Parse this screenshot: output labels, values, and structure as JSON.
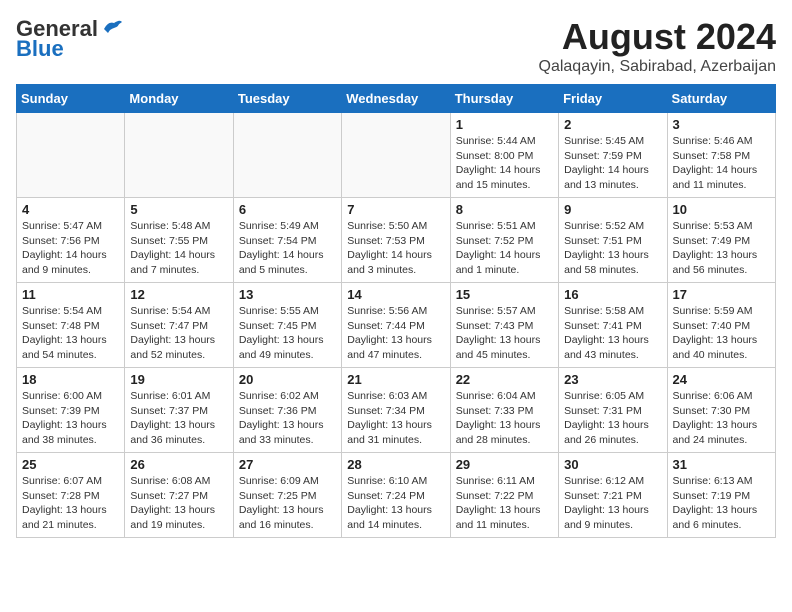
{
  "header": {
    "logo_general": "General",
    "logo_blue": "Blue",
    "month_title": "August 2024",
    "location": "Qalaqayin, Sabirabad, Azerbaijan"
  },
  "weekdays": [
    "Sunday",
    "Monday",
    "Tuesday",
    "Wednesday",
    "Thursday",
    "Friday",
    "Saturday"
  ],
  "weeks": [
    [
      {
        "day": "",
        "info": ""
      },
      {
        "day": "",
        "info": ""
      },
      {
        "day": "",
        "info": ""
      },
      {
        "day": "",
        "info": ""
      },
      {
        "day": "1",
        "info": "Sunrise: 5:44 AM\nSunset: 8:00 PM\nDaylight: 14 hours\nand 15 minutes."
      },
      {
        "day": "2",
        "info": "Sunrise: 5:45 AM\nSunset: 7:59 PM\nDaylight: 14 hours\nand 13 minutes."
      },
      {
        "day": "3",
        "info": "Sunrise: 5:46 AM\nSunset: 7:58 PM\nDaylight: 14 hours\nand 11 minutes."
      }
    ],
    [
      {
        "day": "4",
        "info": "Sunrise: 5:47 AM\nSunset: 7:56 PM\nDaylight: 14 hours\nand 9 minutes."
      },
      {
        "day": "5",
        "info": "Sunrise: 5:48 AM\nSunset: 7:55 PM\nDaylight: 14 hours\nand 7 minutes."
      },
      {
        "day": "6",
        "info": "Sunrise: 5:49 AM\nSunset: 7:54 PM\nDaylight: 14 hours\nand 5 minutes."
      },
      {
        "day": "7",
        "info": "Sunrise: 5:50 AM\nSunset: 7:53 PM\nDaylight: 14 hours\nand 3 minutes."
      },
      {
        "day": "8",
        "info": "Sunrise: 5:51 AM\nSunset: 7:52 PM\nDaylight: 14 hours\nand 1 minute."
      },
      {
        "day": "9",
        "info": "Sunrise: 5:52 AM\nSunset: 7:51 PM\nDaylight: 13 hours\nand 58 minutes."
      },
      {
        "day": "10",
        "info": "Sunrise: 5:53 AM\nSunset: 7:49 PM\nDaylight: 13 hours\nand 56 minutes."
      }
    ],
    [
      {
        "day": "11",
        "info": "Sunrise: 5:54 AM\nSunset: 7:48 PM\nDaylight: 13 hours\nand 54 minutes."
      },
      {
        "day": "12",
        "info": "Sunrise: 5:54 AM\nSunset: 7:47 PM\nDaylight: 13 hours\nand 52 minutes."
      },
      {
        "day": "13",
        "info": "Sunrise: 5:55 AM\nSunset: 7:45 PM\nDaylight: 13 hours\nand 49 minutes."
      },
      {
        "day": "14",
        "info": "Sunrise: 5:56 AM\nSunset: 7:44 PM\nDaylight: 13 hours\nand 47 minutes."
      },
      {
        "day": "15",
        "info": "Sunrise: 5:57 AM\nSunset: 7:43 PM\nDaylight: 13 hours\nand 45 minutes."
      },
      {
        "day": "16",
        "info": "Sunrise: 5:58 AM\nSunset: 7:41 PM\nDaylight: 13 hours\nand 43 minutes."
      },
      {
        "day": "17",
        "info": "Sunrise: 5:59 AM\nSunset: 7:40 PM\nDaylight: 13 hours\nand 40 minutes."
      }
    ],
    [
      {
        "day": "18",
        "info": "Sunrise: 6:00 AM\nSunset: 7:39 PM\nDaylight: 13 hours\nand 38 minutes."
      },
      {
        "day": "19",
        "info": "Sunrise: 6:01 AM\nSunset: 7:37 PM\nDaylight: 13 hours\nand 36 minutes."
      },
      {
        "day": "20",
        "info": "Sunrise: 6:02 AM\nSunset: 7:36 PM\nDaylight: 13 hours\nand 33 minutes."
      },
      {
        "day": "21",
        "info": "Sunrise: 6:03 AM\nSunset: 7:34 PM\nDaylight: 13 hours\nand 31 minutes."
      },
      {
        "day": "22",
        "info": "Sunrise: 6:04 AM\nSunset: 7:33 PM\nDaylight: 13 hours\nand 28 minutes."
      },
      {
        "day": "23",
        "info": "Sunrise: 6:05 AM\nSunset: 7:31 PM\nDaylight: 13 hours\nand 26 minutes."
      },
      {
        "day": "24",
        "info": "Sunrise: 6:06 AM\nSunset: 7:30 PM\nDaylight: 13 hours\nand 24 minutes."
      }
    ],
    [
      {
        "day": "25",
        "info": "Sunrise: 6:07 AM\nSunset: 7:28 PM\nDaylight: 13 hours\nand 21 minutes."
      },
      {
        "day": "26",
        "info": "Sunrise: 6:08 AM\nSunset: 7:27 PM\nDaylight: 13 hours\nand 19 minutes."
      },
      {
        "day": "27",
        "info": "Sunrise: 6:09 AM\nSunset: 7:25 PM\nDaylight: 13 hours\nand 16 minutes."
      },
      {
        "day": "28",
        "info": "Sunrise: 6:10 AM\nSunset: 7:24 PM\nDaylight: 13 hours\nand 14 minutes."
      },
      {
        "day": "29",
        "info": "Sunrise: 6:11 AM\nSunset: 7:22 PM\nDaylight: 13 hours\nand 11 minutes."
      },
      {
        "day": "30",
        "info": "Sunrise: 6:12 AM\nSunset: 7:21 PM\nDaylight: 13 hours\nand 9 minutes."
      },
      {
        "day": "31",
        "info": "Sunrise: 6:13 AM\nSunset: 7:19 PM\nDaylight: 13 hours\nand 6 minutes."
      }
    ]
  ]
}
